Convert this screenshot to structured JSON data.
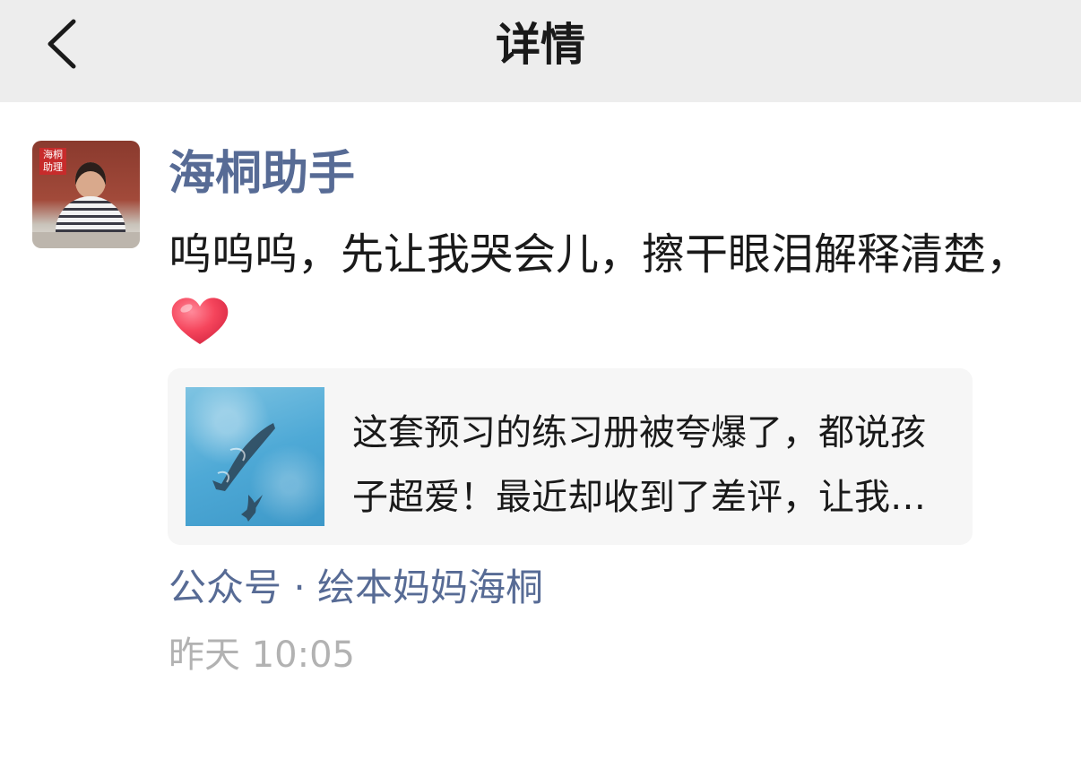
{
  "header": {
    "title": "详情",
    "back_icon": "chevron-left-icon"
  },
  "post": {
    "sender_name": "海桐助手",
    "avatar_seal_text": "海桐助理",
    "message": "呜呜呜，先让我哭会儿，擦干眼泪解释清楚，",
    "emoji": "red-heart",
    "link_card": {
      "title": "这套预习的练习册被夸爆了，都说孩子超爱！最近却收到了差评，让我哭会儿",
      "thumbnail": "swimming-dolphins-image"
    },
    "source": "公众号 · 绘本妈妈海桐",
    "timestamp": "昨天 10:05"
  },
  "colors": {
    "header_bg": "#ededed",
    "link_blue": "#576b95",
    "text": "#1a1a1a",
    "muted": "#b2b2b2",
    "card_bg": "#f6f6f6",
    "heart": "#f5455c"
  }
}
